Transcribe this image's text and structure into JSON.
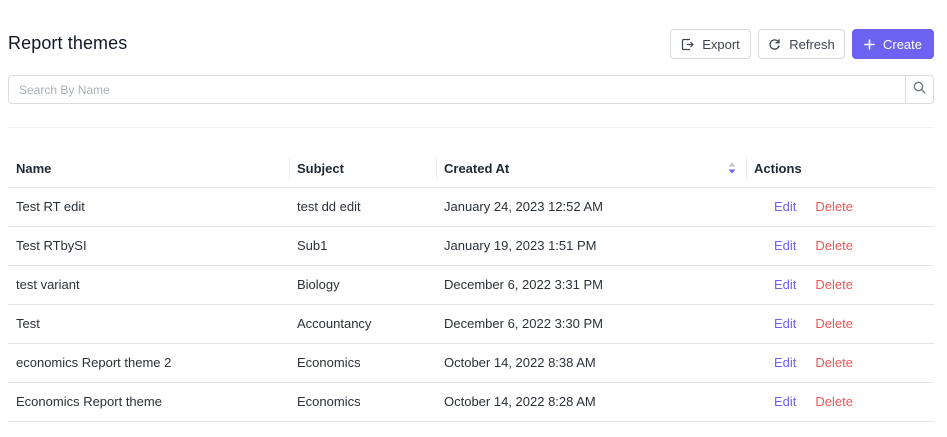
{
  "header": {
    "title": "Report themes",
    "export_label": "Export",
    "refresh_label": "Refresh",
    "create_label": "Create"
  },
  "search": {
    "placeholder": "Search By Name",
    "value": ""
  },
  "table": {
    "columns": [
      "Name",
      "Subject",
      "Created At",
      "Actions"
    ],
    "rows": [
      {
        "name": "Test RT edit",
        "subject": "test dd edit",
        "created_at": "January 24, 2023 12:52 AM",
        "edit": "Edit",
        "delete": "Delete"
      },
      {
        "name": "Test RTbySI",
        "subject": "Sub1",
        "created_at": "January 19, 2023 1:51 PM",
        "edit": "Edit",
        "delete": "Delete"
      },
      {
        "name": "test variant",
        "subject": "Biology",
        "created_at": "December 6, 2022 3:31 PM",
        "edit": "Edit",
        "delete": "Delete"
      },
      {
        "name": "Test",
        "subject": "Accountancy",
        "created_at": "December 6, 2022 3:30 PM",
        "edit": "Edit",
        "delete": "Delete"
      },
      {
        "name": "economics Report theme 2",
        "subject": "Economics",
        "created_at": "October 14, 2022 8:38 AM",
        "edit": "Edit",
        "delete": "Delete"
      },
      {
        "name": "Economics Report theme",
        "subject": "Economics",
        "created_at": "October 14, 2022 8:28 AM",
        "edit": "Edit",
        "delete": "Delete"
      }
    ]
  },
  "colors": {
    "accent": "#6c63f2",
    "delete": "#f05656",
    "border": "#d9dce1"
  },
  "icons": {
    "export": "export-icon",
    "refresh": "refresh-icon",
    "create": "plus-icon",
    "search": "search-icon",
    "sort": "sort-icon"
  }
}
